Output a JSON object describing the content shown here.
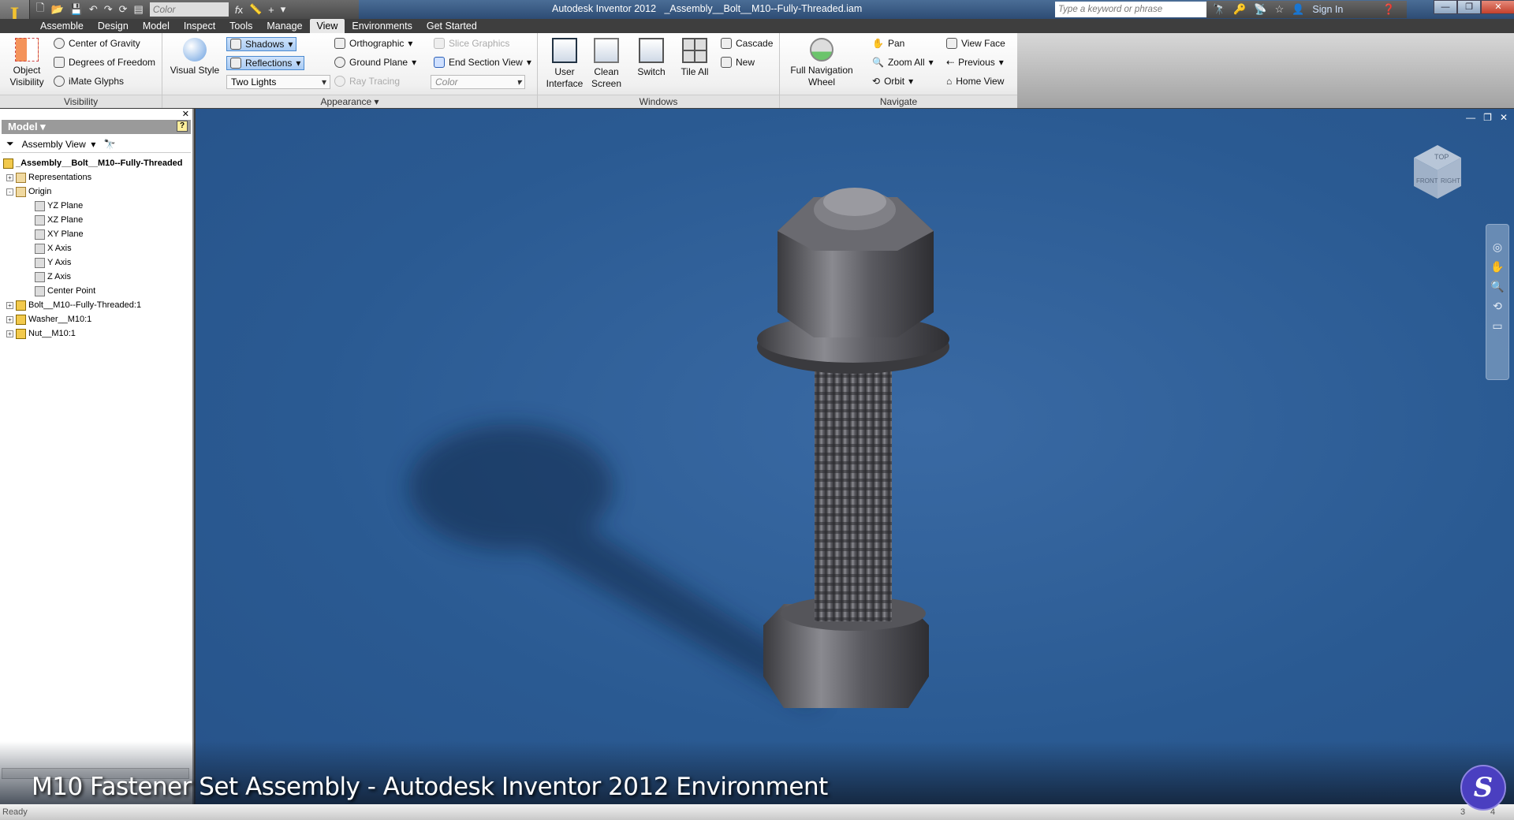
{
  "app": {
    "title": "Autodesk Inventor 2012",
    "document": "_Assembly__Bolt__M10--Fully-Threaded.iam"
  },
  "qat": {
    "style_value": "Color",
    "icons": [
      "new-icon",
      "open-icon",
      "save-icon",
      "undo-icon",
      "redo-icon",
      "fx-icon",
      "measure-icon"
    ]
  },
  "infocenter": {
    "search_placeholder": "Type a keyword or phrase",
    "sign_in": "Sign In"
  },
  "tabs": [
    {
      "label": "Assemble"
    },
    {
      "label": "Design"
    },
    {
      "label": "Model"
    },
    {
      "label": "Inspect"
    },
    {
      "label": "Tools"
    },
    {
      "label": "Manage"
    },
    {
      "label": "View",
      "active": true
    },
    {
      "label": "Environments"
    },
    {
      "label": "Get Started"
    }
  ],
  "ribbon": {
    "visibility": {
      "label": "Visibility",
      "object_visibility": "Object Visibility",
      "center_of_gravity": "Center of Gravity",
      "dof": "Degrees of Freedom",
      "imate": "iMate Glyphs"
    },
    "appearance": {
      "label": "Appearance",
      "visual_style": "Visual Style",
      "shadows": "Shadows",
      "reflections": "Reflections",
      "lighting": "Two Lights",
      "orthographic": "Orthographic",
      "ground_plane": "Ground Plane",
      "ray_tracing": "Ray Tracing",
      "slice_graphics": "Slice Graphics",
      "end_section": "End Section View",
      "color": "Color"
    },
    "windows": {
      "label": "Windows",
      "user_interface": "User Interface",
      "clean_screen": "Clean Screen",
      "switch": "Switch",
      "tile_all": "Tile All",
      "cascade": "Cascade",
      "new": "New"
    },
    "navigate": {
      "label": "Navigate",
      "full_nav_wheel": "Full Navigation Wheel",
      "pan": "Pan",
      "zoom_all": "Zoom All",
      "orbit": "Orbit",
      "view_face": "View Face",
      "previous": "Previous",
      "home_view": "Home View"
    }
  },
  "browser": {
    "title": "Model",
    "view": "Assembly View",
    "tree": [
      {
        "label": "_Assembly__Bolt__M10--Fully-Threaded",
        "level": 0,
        "icon": "assembly"
      },
      {
        "label": "Representations",
        "level": 1,
        "toggle": "+",
        "icon": "folder"
      },
      {
        "label": "Origin",
        "level": 1,
        "toggle": "-",
        "icon": "folder"
      },
      {
        "label": "YZ Plane",
        "level": 2,
        "icon": "plane"
      },
      {
        "label": "XZ Plane",
        "level": 2,
        "icon": "plane"
      },
      {
        "label": "XY Plane",
        "level": 2,
        "icon": "plane"
      },
      {
        "label": "X Axis",
        "level": 2,
        "icon": "axis"
      },
      {
        "label": "Y Axis",
        "level": 2,
        "icon": "axis"
      },
      {
        "label": "Z Axis",
        "level": 2,
        "icon": "axis"
      },
      {
        "label": "Center Point",
        "level": 2,
        "icon": "point"
      },
      {
        "label": "Bolt__M10--Fully-Threaded:1",
        "level": 1,
        "toggle": "+",
        "icon": "part"
      },
      {
        "label": "Washer__M10:1",
        "level": 1,
        "toggle": "+",
        "icon": "part"
      },
      {
        "label": "Nut__M10:1",
        "level": 1,
        "toggle": "+",
        "icon": "part"
      }
    ]
  },
  "viewcube": {
    "top": "TOP",
    "front": "FRONT",
    "right": "RIGHT"
  },
  "caption": "M10 Fastener Set Assembly - Autodesk Inventor 2012 Environment",
  "status": {
    "text": "Ready",
    "count1": "3",
    "count2": "4"
  },
  "colors": {
    "viewport": "#2a5a92",
    "accent": "#4b8ad0"
  }
}
